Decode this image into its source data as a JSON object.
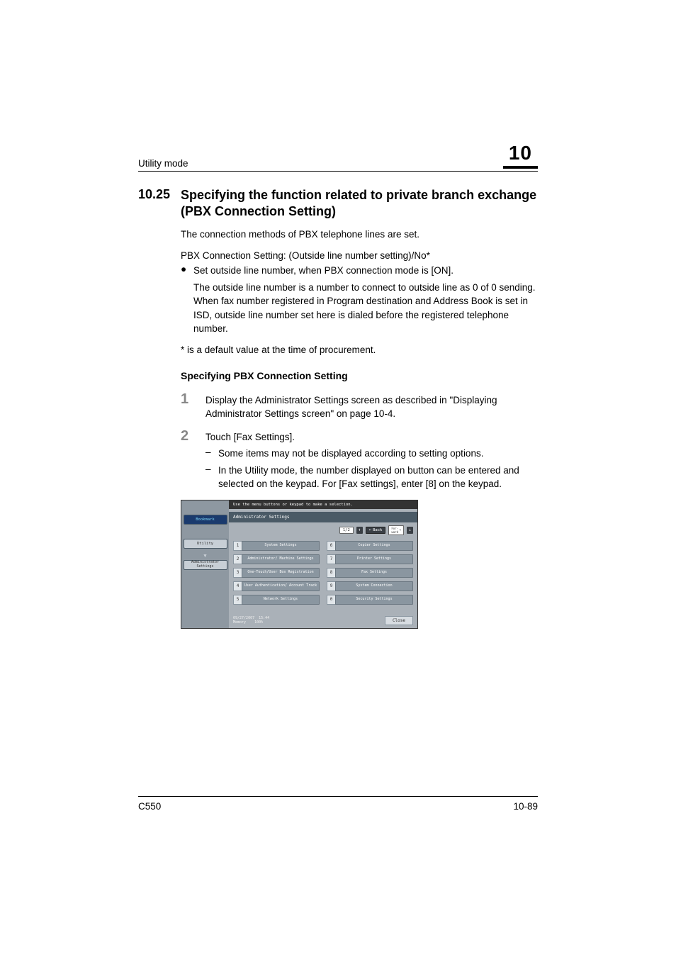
{
  "header": {
    "breadcrumb": "Utility mode",
    "chapter": "10"
  },
  "section": {
    "number": "10.25",
    "title": "Specifying the function related to private branch exchange (PBX Connection Setting)"
  },
  "intro": {
    "p1": "The connection methods of PBX telephone lines are set.",
    "p2": "PBX Connection Setting: (Outside line number setting)/No*",
    "b1": "Set outside line number, when PBX connection mode is [ON].",
    "b1a": "The outside line number is a number to connect to outside line as 0 of 0 sending.",
    "b1b": "When fax number registered in Program destination and Address Book is set in ISD, outside line number set here is dialed before the registered telephone number.",
    "note": "* is a default value at the time of procurement."
  },
  "subheading": "Specifying PBX Connection Setting",
  "steps": [
    {
      "num": "1",
      "text": "Display the Administrator Settings screen as described in \"Displaying Administrator Settings screen\" on page 10-4."
    },
    {
      "num": "2",
      "text": "Touch [Fax Settings].",
      "sub": [
        "Some items may not be displayed according to setting options.",
        "In the Utility mode, the number displayed on button can be entered and selected on the keypad. For [Fax settings], enter [8] on the keypad."
      ]
    }
  ],
  "screen": {
    "instruction": "Use the menu buttons or keypad to make a selection.",
    "bookmark": "Bookmark",
    "utility": "Utility",
    "admin": "Administrator Settings",
    "title": "Administrator Settings",
    "page_ind": "1/2",
    "back": "Back",
    "forward": "Forward",
    "menu": [
      {
        "n": "1",
        "label": "System Settings"
      },
      {
        "n": "6",
        "label": "Copier Settings"
      },
      {
        "n": "2",
        "label": "Administrator/ Machine Settings"
      },
      {
        "n": "7",
        "label": "Printer Settings"
      },
      {
        "n": "3",
        "label": "One-Touch/User Box Registration"
      },
      {
        "n": "8",
        "label": "Fax Settings"
      },
      {
        "n": "4",
        "label": "User Authentication/ Account Track"
      },
      {
        "n": "9",
        "label": "System Connection"
      },
      {
        "n": "5",
        "label": "Network Settings"
      },
      {
        "n": "0",
        "label": "Security Settings"
      }
    ],
    "date": "09/27/2007",
    "time": "15:44",
    "memory_label": "Memory",
    "memory_val": "100%",
    "close": "Close"
  },
  "footer": {
    "model": "C550",
    "page": "10-89"
  }
}
